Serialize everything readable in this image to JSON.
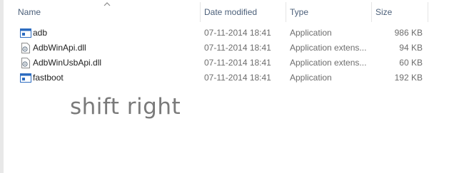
{
  "columns": {
    "name": "Name",
    "date_modified": "Date modified",
    "type": "Type",
    "size": "Size"
  },
  "files": [
    {
      "name": "adb",
      "date": "07-11-2014 18:41",
      "type": "Application",
      "size": "986 KB",
      "icon": "app-icon"
    },
    {
      "name": "AdbWinApi.dll",
      "date": "07-11-2014 18:41",
      "type": "Application extens...",
      "size": "94 KB",
      "icon": "dll-icon"
    },
    {
      "name": "AdbWinUsbApi.dll",
      "date": "07-11-2014 18:41",
      "type": "Application extens...",
      "size": "60 KB",
      "icon": "dll-icon"
    },
    {
      "name": "fastboot",
      "date": "07-11-2014 18:41",
      "type": "Application",
      "size": "192 KB",
      "icon": "app-icon"
    }
  ],
  "overlay": {
    "text": "shift right"
  },
  "colors": {
    "header_text": "#4c607a",
    "detail_text": "#6d6d6d",
    "app_icon_blue": "#2d6cc0"
  }
}
